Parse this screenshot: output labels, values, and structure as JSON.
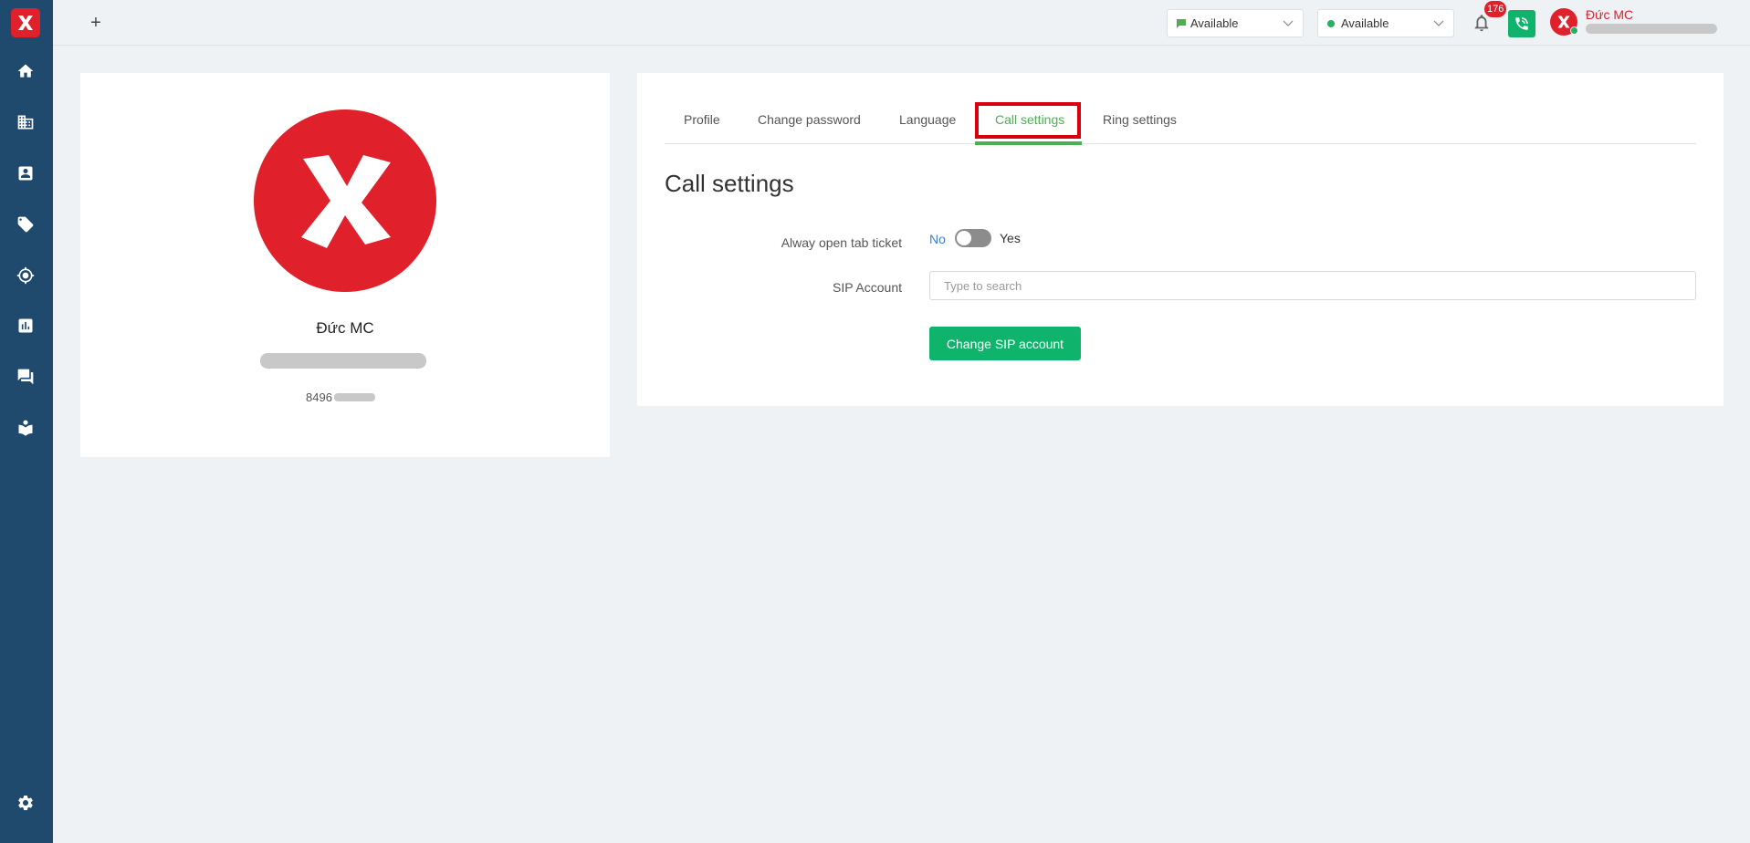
{
  "sidebar": {
    "logo": "x-logo",
    "items": [
      {
        "icon": "home-icon"
      },
      {
        "icon": "building-icon"
      },
      {
        "icon": "contact-card-icon"
      },
      {
        "icon": "tag-icon"
      },
      {
        "icon": "target-icon"
      },
      {
        "icon": "report-chart-icon"
      },
      {
        "icon": "chat-icon"
      },
      {
        "icon": "book-icon"
      }
    ],
    "settings_icon": "gear-icon"
  },
  "topbar": {
    "add_label": "+",
    "chat_status": "Available",
    "call_status": "Available",
    "notification_count": "176",
    "user_name": "Đức MC",
    "colors": {
      "brand_red": "#e0202a",
      "green": "#10b36c",
      "sidebar": "#1f4a6e"
    }
  },
  "profile": {
    "name": "Đức MC",
    "phone_prefix": "8496"
  },
  "settings": {
    "tabs": [
      {
        "label": "Profile"
      },
      {
        "label": "Change password"
      },
      {
        "label": "Language"
      },
      {
        "label": "Call settings",
        "active": true
      },
      {
        "label": "Ring settings"
      }
    ],
    "title": "Call settings",
    "always_open_label": "Alway open tab ticket",
    "toggle_no": "No",
    "toggle_yes": "Yes",
    "toggle_value": false,
    "sip_label": "SIP Account",
    "sip_placeholder": "Type to search",
    "sip_value": "",
    "change_button": "Change SIP account"
  }
}
